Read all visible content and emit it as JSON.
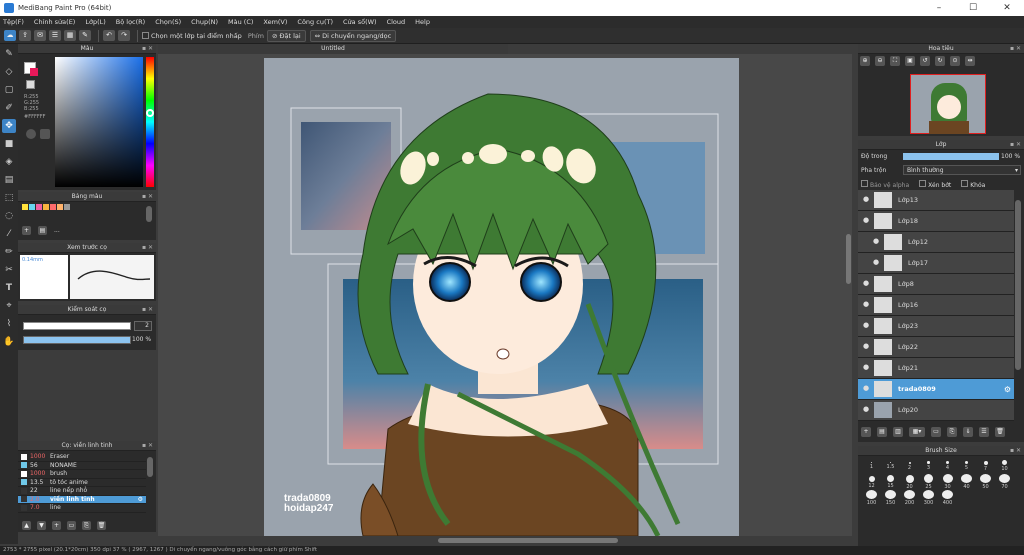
{
  "window": {
    "title": "MediBang Paint Pro (64bit)"
  },
  "menu": [
    "Tệp(F)",
    "Chỉnh sửa(E)",
    "Lớp(L)",
    "Bộ lọc(R)",
    "Chọn(S)",
    "Chụp(N)",
    "Màu (C)",
    "Xem(V)",
    "Công cụ(T)",
    "Cửa sổ(W)",
    "Cloud",
    "Help"
  ],
  "toolbar": {
    "select_layer_label": "Chọn một lớp tại điểm nhấp",
    "key_label": "Phím",
    "reset_label": "Đặt lại",
    "move_label": "Di chuyển ngang/dọc"
  },
  "panels": {
    "color": {
      "title": "Màu",
      "r": "R:255",
      "g": "G:255",
      "b": "B:255",
      "hex": "#FFFFFF"
    },
    "palette": {
      "title": "Bảng màu",
      "more": "..."
    },
    "brush_preview": {
      "title": "Xem trước cọ",
      "size": "0.14mm"
    },
    "brush_control": {
      "title": "Kiểm soát cọ",
      "size_value": "2",
      "opacity_value": "100 %"
    },
    "brush_list": {
      "title": "Cọ: viền linh tinh",
      "items": [
        {
          "size": "1000",
          "name": "Eraser",
          "color": "#ffffff"
        },
        {
          "size": "56",
          "name": "NONAME",
          "color": "#6fc8e8"
        },
        {
          "size": "1000",
          "name": "brush",
          "color": "#ffffff"
        },
        {
          "size": "13.5",
          "name": "tô tóc anime",
          "color": "#6fc8e8"
        },
        {
          "size": "22",
          "name": "line nếp nhỏ",
          "color": "#333333"
        },
        {
          "size": "2.0",
          "name": "viền linh tinh",
          "color": "#333333"
        },
        {
          "size": "7.0",
          "name": "line",
          "color": "#333333"
        }
      ]
    },
    "navigator": {
      "title": "Hoa tiêu"
    },
    "layers": {
      "title": "Lớp",
      "opacity_label": "Độ trong",
      "opacity_value": "100 %",
      "blend_label": "Pha trộn",
      "blend_value": "Bình thường",
      "protect_alpha": "Bảo vệ alpha",
      "clipping": "Xén bớt",
      "lock": "Khóa",
      "items": [
        {
          "name": "Lớp13"
        },
        {
          "name": "Lớp18"
        },
        {
          "name": "Lớp12"
        },
        {
          "name": "Lớp17"
        },
        {
          "name": "Lớp8"
        },
        {
          "name": "Lớp16"
        },
        {
          "name": "Lớp23"
        },
        {
          "name": "Lớp22"
        },
        {
          "name": "Lớp21"
        },
        {
          "name": "trada0809"
        },
        {
          "name": "Lớp20"
        }
      ]
    },
    "brush_size": {
      "title": "Brush Size",
      "values": [
        "1",
        "1.5",
        "2",
        "3",
        "4",
        "5",
        "7",
        "10",
        "12",
        "15",
        "20",
        "25",
        "30",
        "40",
        "50",
        "70",
        "100",
        "150",
        "200",
        "300",
        "400"
      ]
    }
  },
  "canvas": {
    "tab": "Untitled",
    "signature_line1": "trada0809",
    "signature_line2": "hoidap247"
  },
  "status": "2753 * 2755 pixel  (20.1*20cm)  350 dpi  37 %  ( 2967, 1267 )  Di chuyển ngang/vuông góc bằng cách giữ phím Shift"
}
